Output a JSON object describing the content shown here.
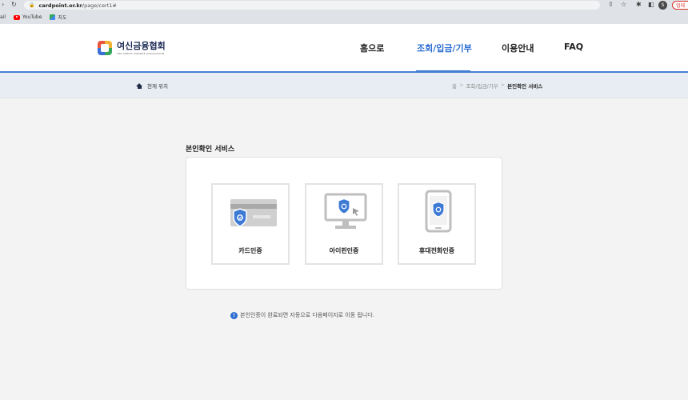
{
  "browser": {
    "url_host": "cardpoint.or.kr",
    "url_path": "/page/cert1#",
    "bookmarks": [
      {
        "label": "ail"
      },
      {
        "label": "YouTube",
        "icon": "youtube-icon"
      },
      {
        "label": "지도",
        "icon": "maps-icon"
      }
    ],
    "profile_initial": "S",
    "update_label": "업데"
  },
  "header": {
    "logo_text": "여신금융협회",
    "logo_subtext": "THE CREDIT FINANCE ASSOCIATION",
    "nav": [
      {
        "label": "홈으로",
        "active": false
      },
      {
        "label": "조회/입금/기부",
        "active": true
      },
      {
        "label": "이용안내",
        "active": false
      },
      {
        "label": "FAQ",
        "active": false
      }
    ]
  },
  "breadcrumb_bar": {
    "location_label": "현재 위치",
    "crumbs": [
      "홈",
      "조회/입금/기부",
      "본인확인 서비스"
    ],
    "separator": ">"
  },
  "main": {
    "section_title": "본인확인 서비스",
    "cards": [
      {
        "label": "카드인증",
        "icon": "credit-card-shield-icon"
      },
      {
        "label": "아이핀인증",
        "icon": "monitor-shield-icon"
      },
      {
        "label": "휴대전화인증",
        "icon": "mobile-phone-shield-icon"
      }
    ],
    "notice": "본인인증이 완료되면 자동으로 다음페이지로 이동 됩니다."
  },
  "colors": {
    "accent": "#2b6cd1",
    "icon_gray": "#c9c9c9",
    "shield_blue": "#3d7ad6",
    "breadcrumb_bg": "#e8edf3"
  }
}
